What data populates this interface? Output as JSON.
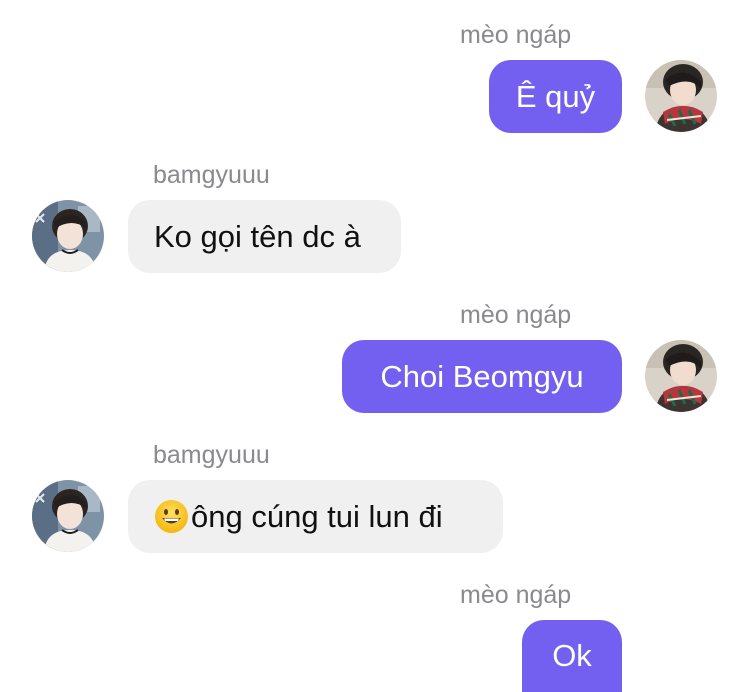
{
  "messages": [
    {
      "direction": "out",
      "sender": "mèo ngáp",
      "text": "Ê quỷ",
      "avatar_icon": "profile-photo-scarf"
    },
    {
      "direction": "in",
      "sender": "bamgyuuu",
      "text": "Ko gọi tên dc à",
      "avatar_icon": "profile-photo-girl"
    },
    {
      "direction": "out",
      "sender": "mèo ngáp",
      "text": "Choi Beomgyu",
      "avatar_icon": "profile-photo-scarf"
    },
    {
      "direction": "in",
      "sender": "bamgyuuu",
      "text": "ông cúng tui lun đi",
      "emoji": "grinning-face",
      "avatar_icon": "profile-photo-girl"
    },
    {
      "direction": "out",
      "sender": "mèo ngáp",
      "text": "Ok"
    }
  ],
  "colors": {
    "outgoing_bubble": "#7360f0",
    "incoming_bubble": "#f0f0f0",
    "sender_name": "#8a8a8e"
  }
}
